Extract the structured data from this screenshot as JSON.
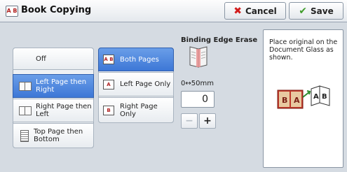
{
  "header": {
    "title": "Book Copying",
    "title_icon_text": "A B",
    "cancel_label": "Cancel",
    "save_label": "Save"
  },
  "layout_options": [
    {
      "label": "Off",
      "selected": false,
      "icon": "none"
    },
    {
      "label": "Left Page then Right",
      "selected": true,
      "icon": "open-book-icon"
    },
    {
      "label": "Right Page then Left",
      "selected": false,
      "icon": "open-book-icon"
    },
    {
      "label": "Top Page then Bottom",
      "selected": false,
      "icon": "document-icon"
    }
  ],
  "page_options": [
    {
      "label": "Both Pages",
      "selected": true,
      "icon_text": "A B"
    },
    {
      "label": "Left Page Only",
      "selected": false,
      "icon_text": "A"
    },
    {
      "label": "Right Page Only",
      "selected": false,
      "icon_text": "B"
    }
  ],
  "binding": {
    "label": "Binding Edge Erase",
    "range_text": "0↔50mm",
    "value": "0",
    "minus": "−",
    "plus": "+"
  },
  "info": {
    "text": "Place original on the Document Glass as shown."
  },
  "colors": {
    "selected": "#3d77d6",
    "cancel_icon": "#d21b1b",
    "save_icon": "#3f9c2a",
    "background": "#d5dbe2"
  }
}
